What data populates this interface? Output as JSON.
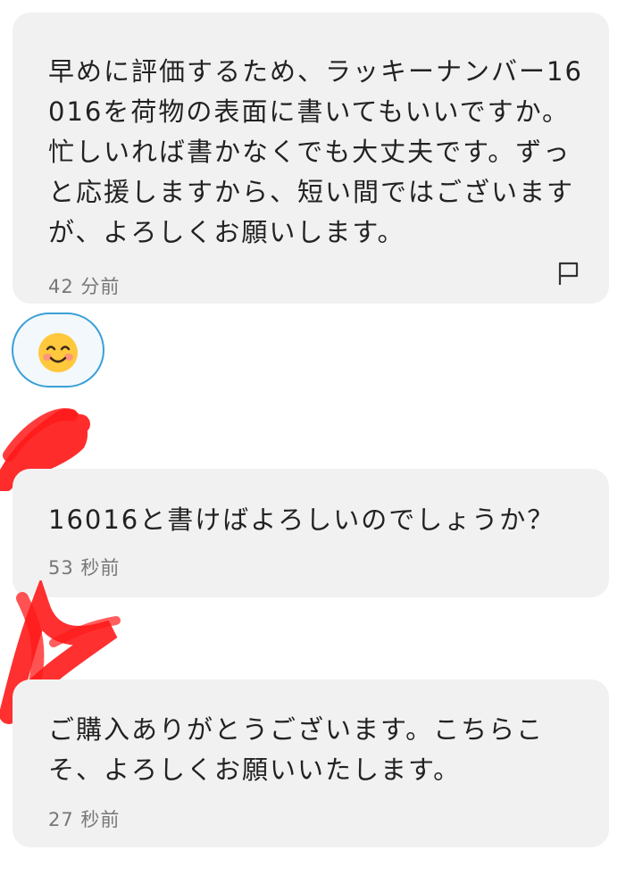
{
  "messages": [
    {
      "text": "早めに評価するため、ラッキーナンバー16016を荷物の表面に書いてもいいですか。忙しいれば書かなくでも大丈夫です。ずっと応援しますから、短い間ではございますが、よろしくお願いします。",
      "time": "42 分前",
      "icon": "flag-icon"
    },
    {
      "text": "16016と書けばよろしいのでしょうか？",
      "time": "53 秒前"
    },
    {
      "text": "ご購入ありがとうございます。こちらこそ、よろしくお願いいたします。",
      "time": "27 秒前"
    }
  ],
  "reaction": {
    "icon": "smiling-face-icon"
  },
  "colors": {
    "bubble_bg": "#f1f1f1",
    "reaction_border": "#3aa0d8",
    "redaction": "#ff1a1a",
    "emoji_yellow": "#ffc83d"
  }
}
